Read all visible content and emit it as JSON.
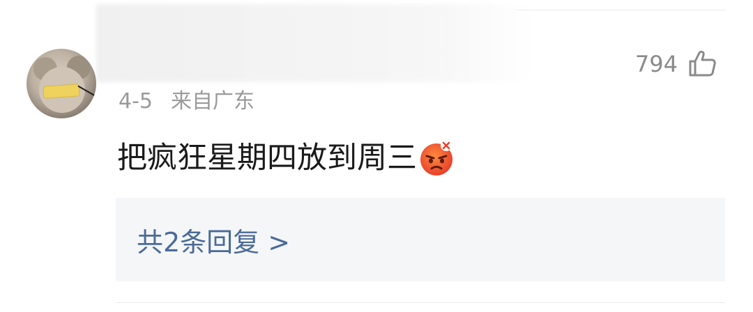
{
  "comment": {
    "likes": "794",
    "date": "4-5",
    "location": "来自广东",
    "text": "把疯狂星期四放到周三",
    "emoji": "angry-face"
  },
  "replies": {
    "label": "共2条回复 >"
  },
  "colors": {
    "link": "#4a6b98",
    "meta": "#9a9a9a",
    "reply_bg": "#f5f6f8"
  }
}
